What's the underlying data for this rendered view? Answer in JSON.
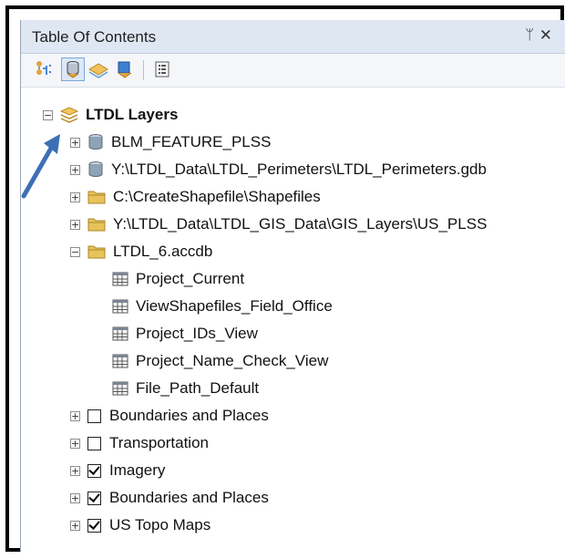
{
  "panel": {
    "title": "Table Of Contents",
    "pin_glyph": "ᛘ",
    "close_glyph": "✕"
  },
  "toolbar": {
    "buttons": [
      {
        "name": "list-by-drawing-order-icon"
      },
      {
        "name": "list-by-source-icon"
      },
      {
        "name": "list-by-visibility-icon"
      },
      {
        "name": "list-by-selection-icon"
      },
      {
        "name": "options-icon"
      }
    ]
  },
  "tree": {
    "root": {
      "label": "LTDL Layers",
      "expander": "−"
    },
    "items": [
      {
        "label": "BLM_FEATURE_PLSS",
        "expander": "+",
        "icon": "database-icon"
      },
      {
        "label": "Y:\\LTDL_Data\\LTDL_Perimeters\\LTDL_Perimeters.gdb",
        "expander": "+",
        "icon": "database-icon"
      },
      {
        "label": "C:\\CreateShapefile\\Shapefiles",
        "expander": "+",
        "icon": "folder-icon"
      },
      {
        "label": "Y:\\LTDL_Data\\LTDL_GIS_Data\\GIS_Layers\\US_PLSS",
        "expander": "+",
        "icon": "folder-icon"
      },
      {
        "label": "LTDL_6.accdb",
        "expander": "−",
        "icon": "folder-icon"
      }
    ],
    "tables": [
      {
        "label": "Project_Current"
      },
      {
        "label": "ViewShapefiles_Field_Office"
      },
      {
        "label": "Project_IDs_View"
      },
      {
        "label": "Project_Name_Check_View"
      },
      {
        "label": "File_Path_Default"
      }
    ],
    "layers": [
      {
        "label": "Boundaries and Places",
        "checked": false,
        "expander": "+"
      },
      {
        "label": "Transportation",
        "checked": false,
        "expander": "+"
      },
      {
        "label": "Imagery",
        "checked": true,
        "expander": "+"
      },
      {
        "label": "Boundaries and Places",
        "checked": true,
        "expander": "+"
      },
      {
        "label": "US Topo Maps",
        "checked": true,
        "expander": "+"
      }
    ]
  },
  "colors": {
    "titlebar": "#dfe7f3",
    "arrow": "#3d6fb5",
    "folder": "#e8c35a",
    "database": "#8fa2b8"
  }
}
